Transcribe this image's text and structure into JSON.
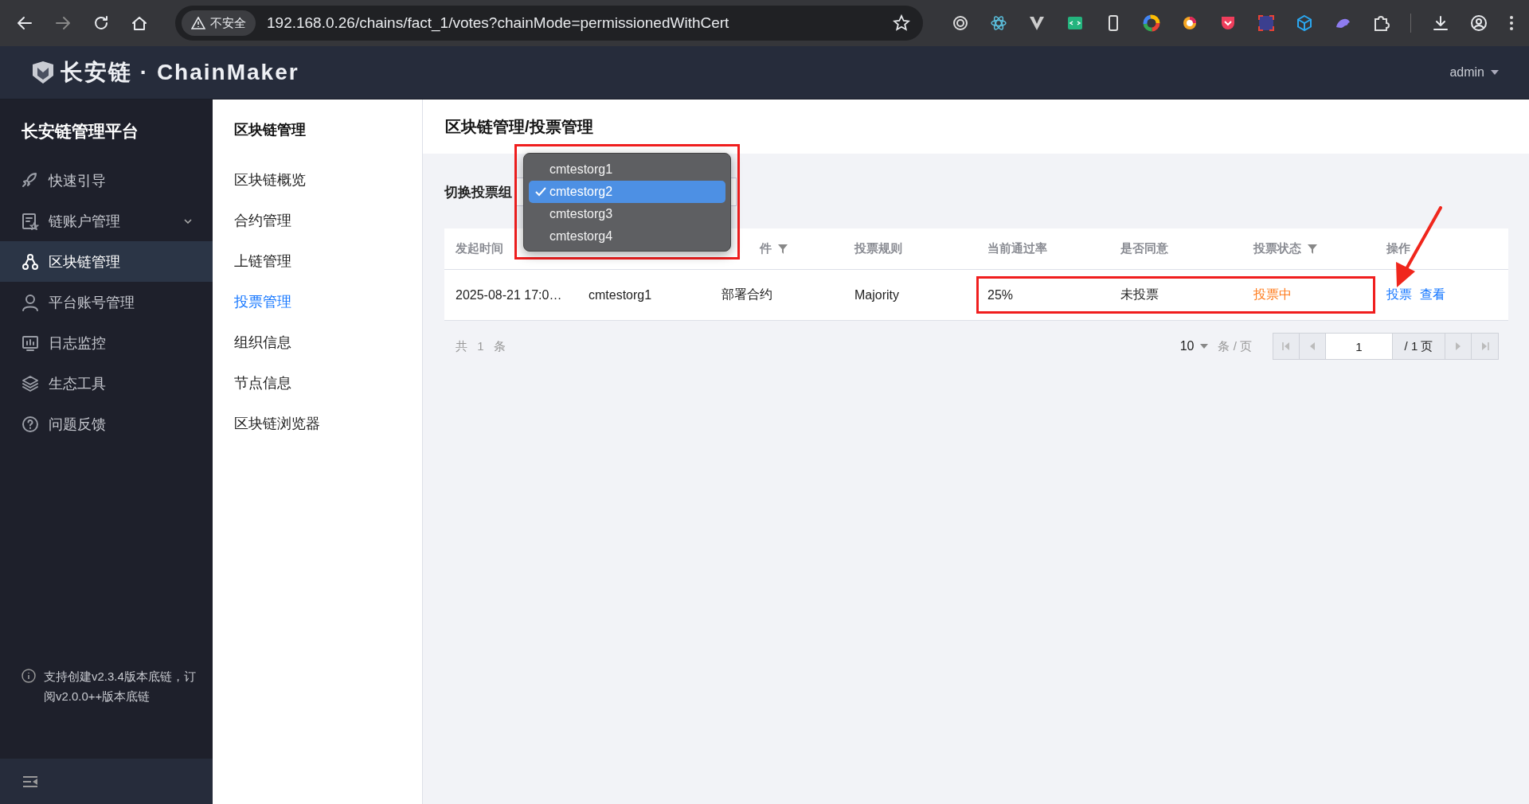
{
  "browser": {
    "security_label": "不安全",
    "url": "192.168.0.26/chains/fact_1/votes?chainMode=permissionedWithCert"
  },
  "app_header": {
    "logo_text": "长安链 · ChainMaker",
    "user": "admin"
  },
  "sidebar": {
    "title": "长安链管理平台",
    "items": [
      {
        "label": "快速引导",
        "selected": false,
        "has_caret": false
      },
      {
        "label": "链账户管理",
        "selected": false,
        "has_caret": true
      },
      {
        "label": "区块链管理",
        "selected": true,
        "has_caret": false
      },
      {
        "label": "平台账号管理",
        "selected": false,
        "has_caret": false
      },
      {
        "label": "日志监控",
        "selected": false,
        "has_caret": false
      },
      {
        "label": "生态工具",
        "selected": false,
        "has_caret": false
      },
      {
        "label": "问题反馈",
        "selected": false,
        "has_caret": false
      }
    ],
    "footer_note": "支持创建v2.3.4版本底链，订阅v2.0.0++版本底链"
  },
  "subnav": {
    "title": "区块链管理",
    "items": [
      {
        "label": "区块链概览",
        "selected": false
      },
      {
        "label": "合约管理",
        "selected": false
      },
      {
        "label": "上链管理",
        "selected": false
      },
      {
        "label": "投票管理",
        "selected": true
      },
      {
        "label": "组织信息",
        "selected": false
      },
      {
        "label": "节点信息",
        "selected": false
      },
      {
        "label": "区块链浏览器",
        "selected": false
      }
    ]
  },
  "main": {
    "title": "区块链管理/投票管理",
    "org_switch": {
      "label": "切换投票组",
      "highlighted": true,
      "options": [
        {
          "label": "cmtestorg1",
          "selected": false
        },
        {
          "label": "cmtestorg2",
          "selected": true
        },
        {
          "label": "cmtestorg3",
          "selected": false
        },
        {
          "label": "cmtestorg4",
          "selected": false
        }
      ]
    },
    "table": {
      "columns": [
        {
          "label": "发起时间",
          "filter": false
        },
        {
          "filter": false
        },
        {
          "label": "件",
          "filter": true
        },
        {
          "label": "投票规则",
          "filter": false
        },
        {
          "label": "当前通过率",
          "filter": false
        },
        {
          "label": "是否同意",
          "filter": false
        },
        {
          "label": "投票状态",
          "filter": true
        },
        {
          "label": "操作",
          "filter": false
        }
      ],
      "rows": [
        {
          "cells": [
            {
              "kind": "text",
              "text": "2025-08-21 17:0…",
              "highlighted": false
            },
            {
              "kind": "text",
              "text": "cmtestorg1",
              "highlighted": false
            },
            {
              "kind": "text",
              "text": "部署合约",
              "highlighted": false
            },
            {
              "kind": "text",
              "text": "Majority",
              "highlighted": false
            },
            {
              "kind": "text",
              "text": "25%",
              "highlighted": true
            },
            {
              "kind": "text",
              "text": "未投票",
              "highlighted": true
            },
            {
              "kind": "status",
              "text": "投票中",
              "highlighted": true
            },
            {
              "kind": "actions",
              "actions": [
                {
                  "label": "投票",
                  "pointed": true
                },
                {
                  "label": "查看",
                  "pointed": false
                }
              ],
              "highlighted": false
            }
          ]
        }
      ]
    },
    "pagination": {
      "total": "共 1 条",
      "page_size": "10",
      "page_size_unit": "条 / 页",
      "page": "1",
      "page_total": "/ 1 页"
    }
  }
}
